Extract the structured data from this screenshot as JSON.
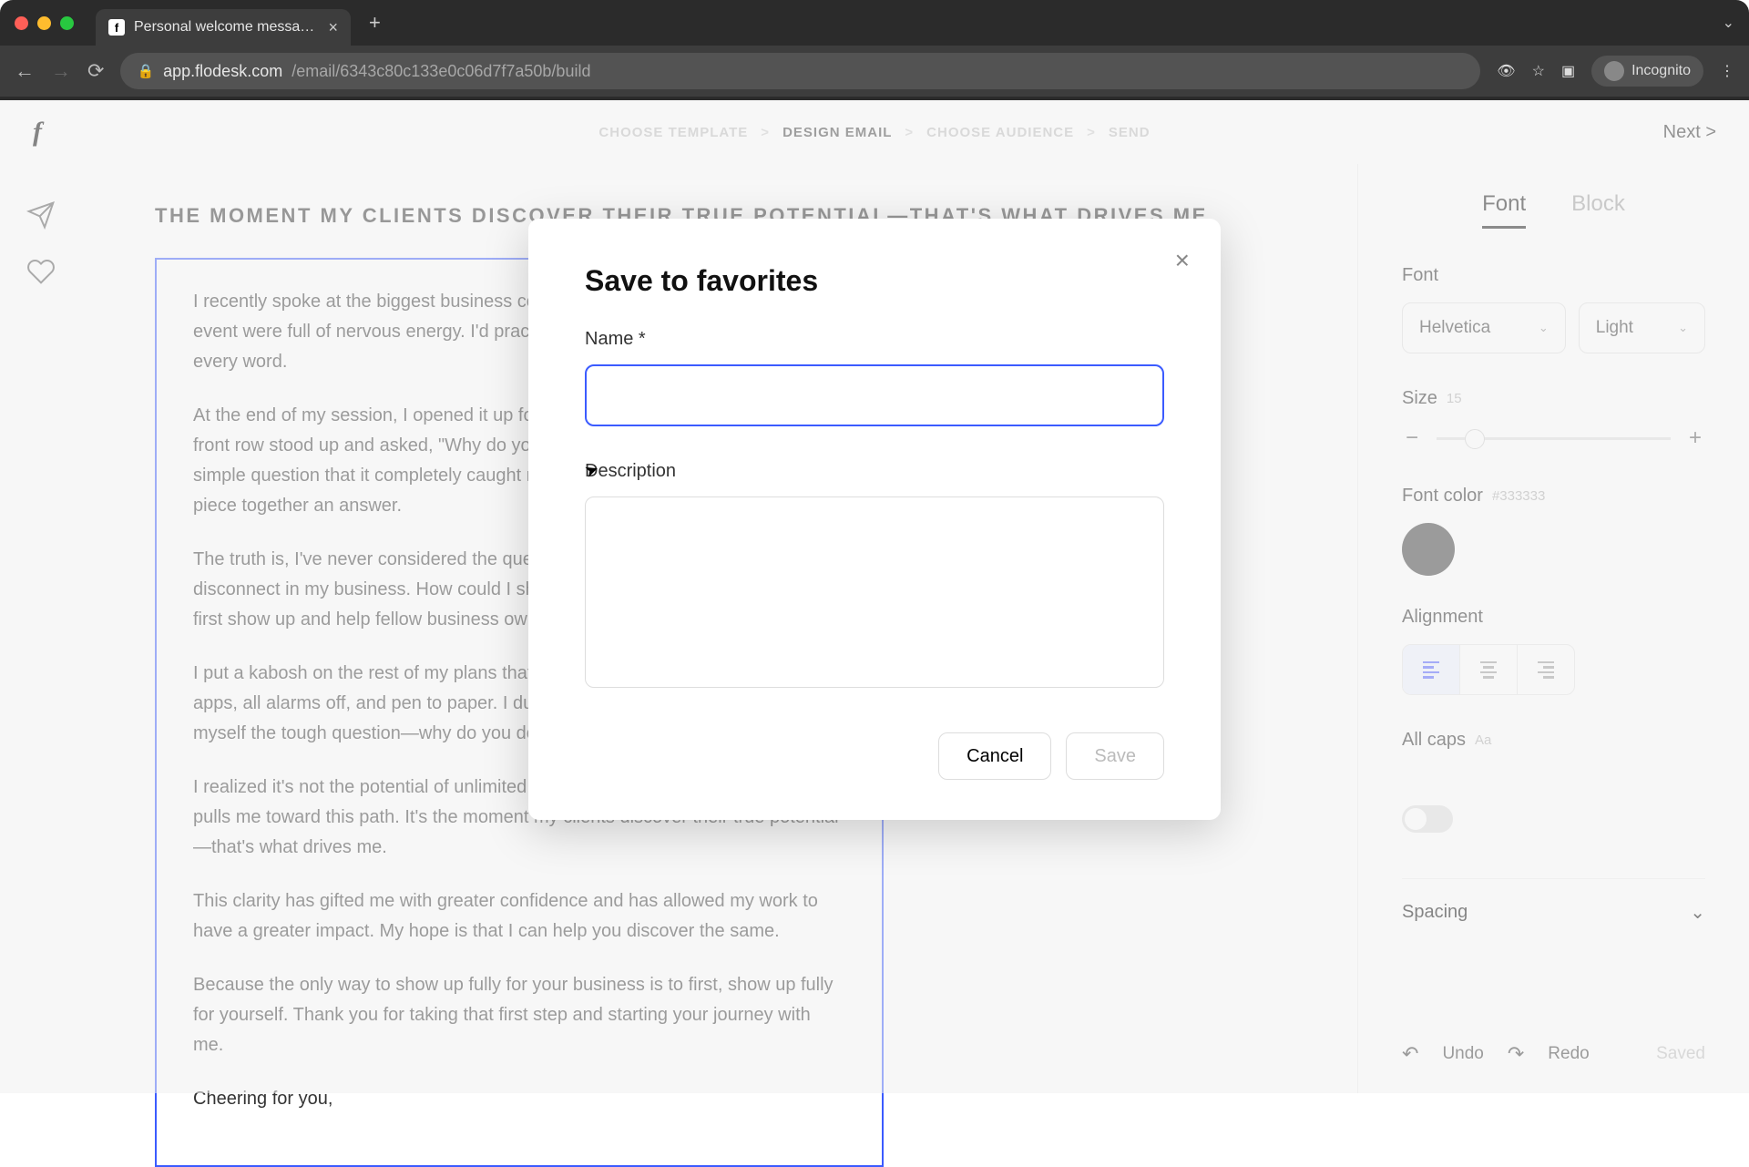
{
  "browser": {
    "tab_title": "Personal welcome message | F",
    "url_host": "app.flodesk.com",
    "url_path": "/email/6343c80c133e0c06d7f7a50b/build",
    "incognito_label": "Incognito"
  },
  "header": {
    "steps": [
      "CHOOSE TEMPLATE",
      "DESIGN EMAIL",
      "CHOOSE AUDIENCE",
      "SEND"
    ],
    "active_step_index": 1,
    "next_label": "Next  >"
  },
  "email": {
    "heading": "THE MOMENT MY CLIENTS DISCOVER THEIR TRUE POTENTIAL—THAT'S WHAT DRIVES ME",
    "paragraphs": [
      "I recently spoke at the biggest business conference. The weeks leading up to the event were full of nervous energy. I'd practiced my presentation and memorized every word.",
      "At the end of my session, I opened it up for questions. An eager attendee in the front row stood up and asked, \"Why do you do what you do?\" It was such a simple question that it completely caught me off guard. My brain scrambled to piece together an answer.",
      "The truth is, I've never considered the question before. That moment unveiled a disconnect in my business. How could I show up fully for my business if I didn't first show up and help fellow business owners if I was running on autopilot?",
      "I put a kabosh on the rest of my plans that evening. I went back to my hotel, all apps, all alarms off, and pen to paper. I dug into my own story again and asked myself the tough question—why do you do what you do?",
      "I realized it's not the potential of unlimited income or being my own boss that pulls me toward this path. It's the moment my clients discover their true potential—that's what drives me.",
      "This clarity has gifted me with greater confidence and has allowed my work to have a greater impact. My hope is that I can help you discover the same.",
      "Because the only way to show up fully for your business is to first, show up fully for yourself. Thank you for taking that first step and starting your journey with me.",
      "Cheering for you,"
    ]
  },
  "sidebar": {
    "tabs": [
      "Font",
      "Block"
    ],
    "active_tab_index": 0,
    "font_label": "Font",
    "font_family": "Helvetica",
    "font_weight": "Light",
    "size_label": "Size",
    "size_value": "15",
    "color_label": "Font color",
    "color_hex": "#333333",
    "alignment_label": "Alignment",
    "allcaps_label": "All caps",
    "allcaps_hint": "Aa",
    "spacing_label": "Spacing",
    "undo_label": "Undo",
    "redo_label": "Redo",
    "saved_label": "Saved"
  },
  "modal": {
    "title": "Save to favorites",
    "name_label": "Name *",
    "description_label": "Description",
    "cancel_label": "Cancel",
    "save_label": "Save"
  }
}
